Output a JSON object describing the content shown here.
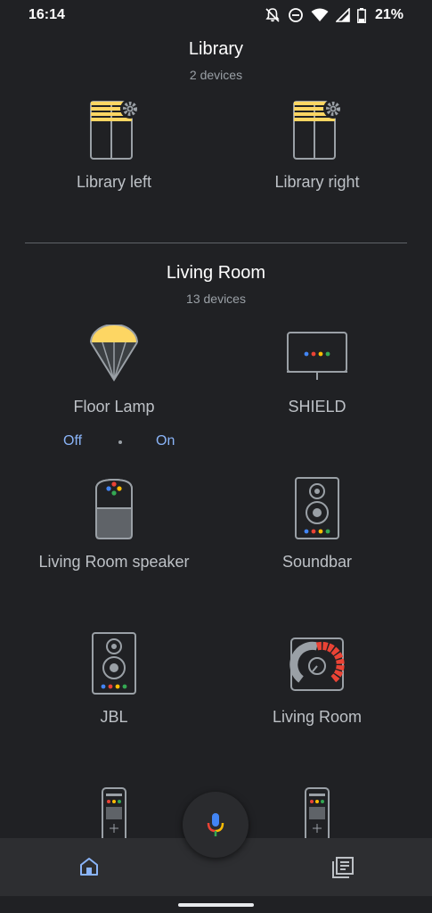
{
  "status": {
    "time": "16:14",
    "battery": "21%",
    "icons": [
      "bell-off-icon",
      "do-not-disturb-icon",
      "wifi-icon",
      "signal-icon",
      "battery-icon"
    ]
  },
  "sections": [
    {
      "title": "Library",
      "subtitle": "2 devices",
      "devices": [
        {
          "label": "Library left",
          "icon": "window-blind-settings-icon"
        },
        {
          "label": "Library right",
          "icon": "window-blind-settings-icon"
        }
      ]
    },
    {
      "title": "Living Room",
      "subtitle": "13 devices",
      "devices": [
        {
          "label": "Floor Lamp",
          "icon": "lamp-icon",
          "toggle": {
            "off": "Off",
            "on": "On"
          }
        },
        {
          "label": "SHIELD",
          "icon": "tv-icon"
        },
        {
          "label": "Living Room speaker",
          "icon": "google-home-speaker-icon"
        },
        {
          "label": "Soundbar",
          "icon": "speaker-icon"
        },
        {
          "label": "JBL",
          "icon": "speaker-icon"
        },
        {
          "label": "Living Room",
          "icon": "speaker-group-icon"
        },
        {
          "label": "",
          "icon": "remote-icon"
        },
        {
          "label": "",
          "icon": "remote-icon"
        }
      ]
    }
  ],
  "nav": {
    "home": "home-icon",
    "feed": "feed-icon",
    "mic": "mic-icon"
  },
  "colors": {
    "background": "#202124",
    "accent_blue": "#8ab4f8",
    "blind_yellow": "#fdd663",
    "google_blue": "#4285f4",
    "google_red": "#ea4335",
    "google_yellow": "#fbbc04",
    "google_green": "#34a853"
  }
}
